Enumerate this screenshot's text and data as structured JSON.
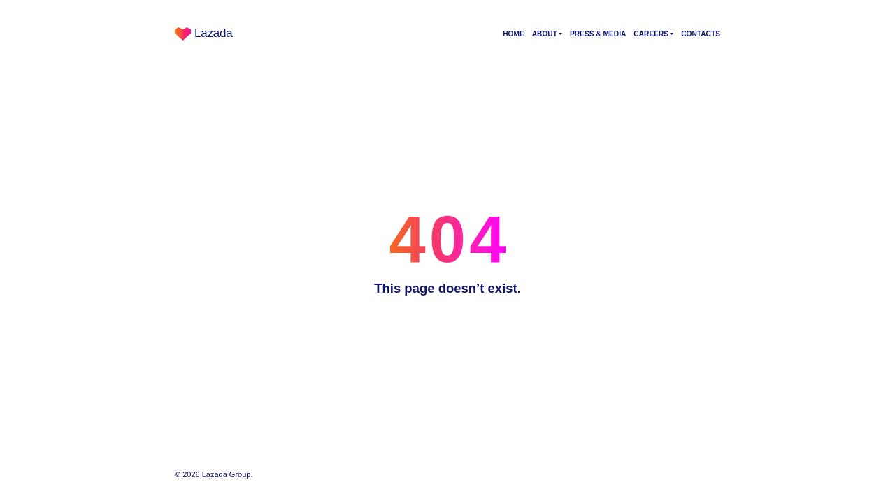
{
  "header": {
    "logo_text": "Lazada",
    "nav": [
      {
        "label": "HOME",
        "kind": "link"
      },
      {
        "label": "ABOUT",
        "kind": "dropdown"
      },
      {
        "label": "PRESS & MEDIA",
        "kind": "link"
      },
      {
        "label": "CAREERS",
        "kind": "dropdown"
      },
      {
        "label": "CONTACTS",
        "kind": "link"
      }
    ]
  },
  "error": {
    "code": "404",
    "message": "This page doesn’t exist."
  },
  "footer": {
    "copyright": "© 2026 Lazada Group."
  }
}
